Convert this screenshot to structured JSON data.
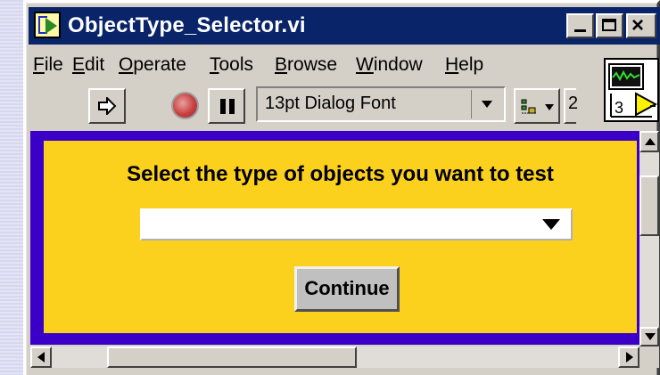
{
  "window": {
    "title": "ObjectType_Selector.vi",
    "controls": [
      "minimize",
      "maximize",
      "close"
    ]
  },
  "menu": [
    {
      "label": "File"
    },
    {
      "label": "Edit"
    },
    {
      "label": "Operate"
    },
    {
      "label": "Tools"
    },
    {
      "label": "Browse"
    },
    {
      "label": "Window"
    },
    {
      "label": "Help"
    }
  ],
  "toolbar": {
    "font_selector_value": "13pt Dialog Font",
    "partial_label": "2"
  },
  "vi_icon": {
    "number": "3"
  },
  "panel": {
    "prompt": "Select the type of objects you want to test",
    "object_type_value": "",
    "continue_label": "Continue",
    "background": "#fcd11e",
    "frame": "#3a00c8"
  }
}
